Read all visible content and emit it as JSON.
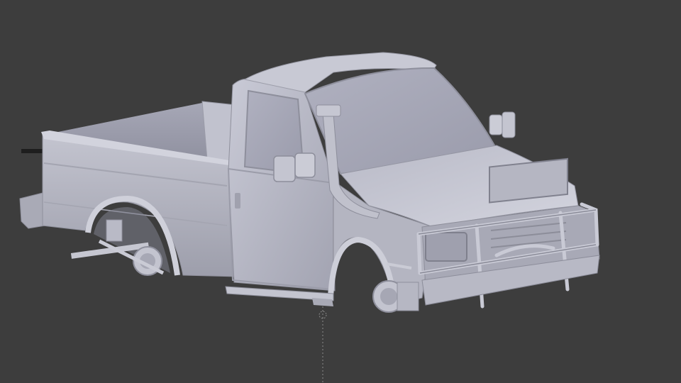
{
  "app": {
    "kind": "3d-viewport",
    "background_color": "#3d3d3d",
    "mesh_color": "#b7b8c4",
    "object": "pickup-truck-mesh",
    "shading": "solid",
    "origin_marker": "3d-cursor-dotted-line"
  }
}
